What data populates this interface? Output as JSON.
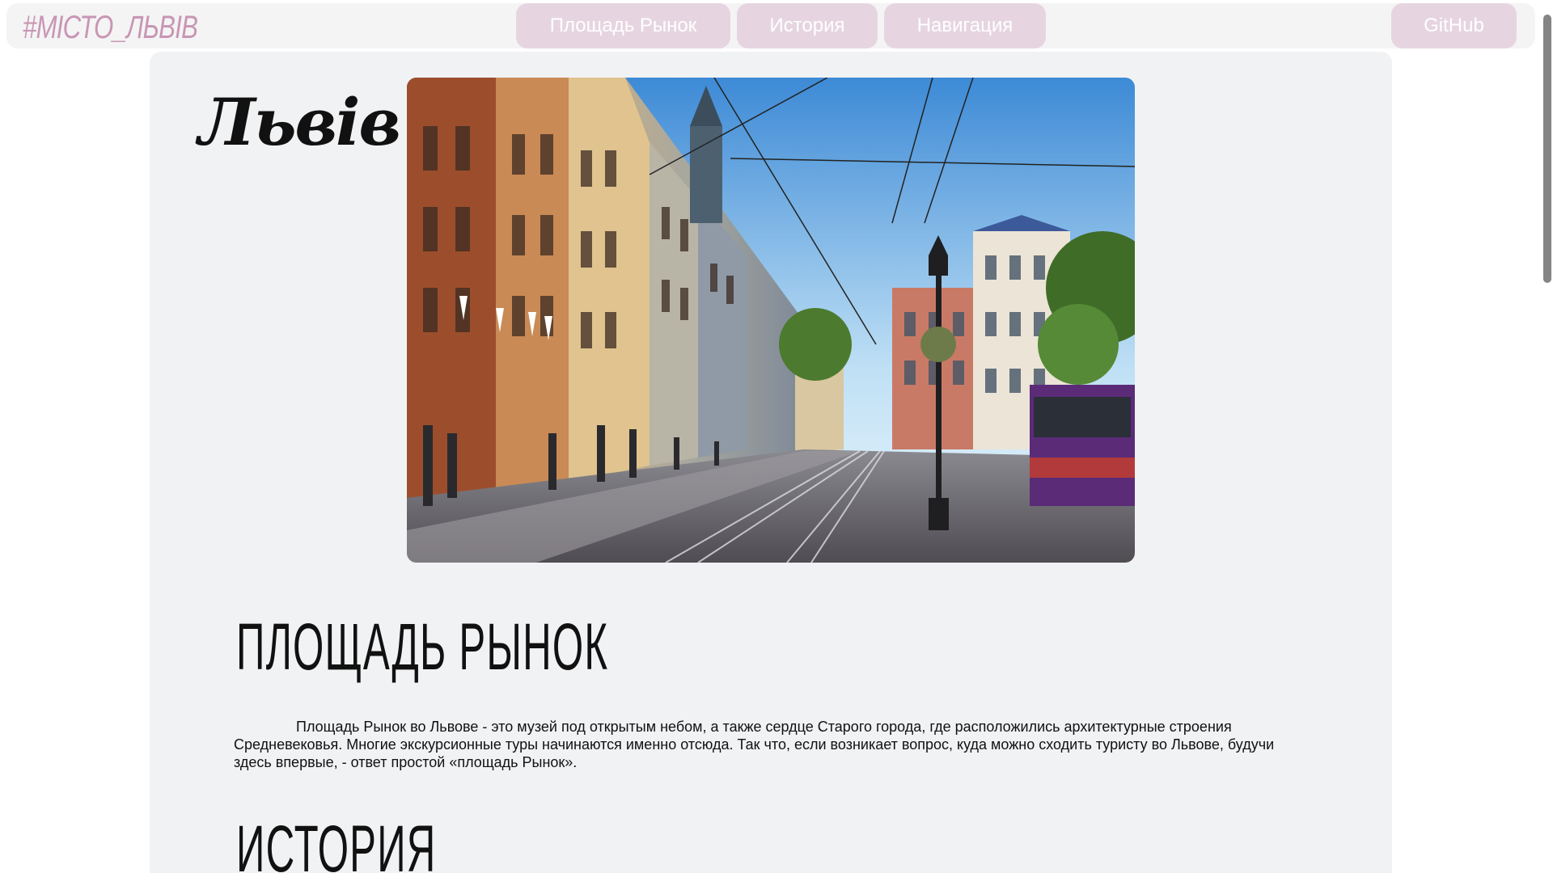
{
  "header": {
    "logo": "#МІСТО_ЛЬВІВ",
    "nav": [
      {
        "label": "Площадь Рынок"
      },
      {
        "label": "История"
      },
      {
        "label": "Навигация"
      }
    ],
    "github_label": "GitHub",
    "colors": {
      "bar_bg": "#f4f4f4",
      "button_bg": "#e6d5e0",
      "logo": "#c896b4"
    }
  },
  "main": {
    "city_title": "Львів",
    "hero_image_icon": "city-street-photo",
    "sections": [
      {
        "title": "ПЛОЩАДЬ РЫНОК",
        "text": "Площадь Рынок во Львове - это музей под открытым небом, а также сердце Старого города, где расположились архитектурные строения Средневековья. Многие экскурсионные туры начинаются именно отсюда. Так что, если возникает вопрос, куда можно сходить туристу во Львове, будучи здесь впервые, - ответ простой «площадь Рынок»."
      },
      {
        "title": "ИСТОРИЯ"
      }
    ]
  }
}
